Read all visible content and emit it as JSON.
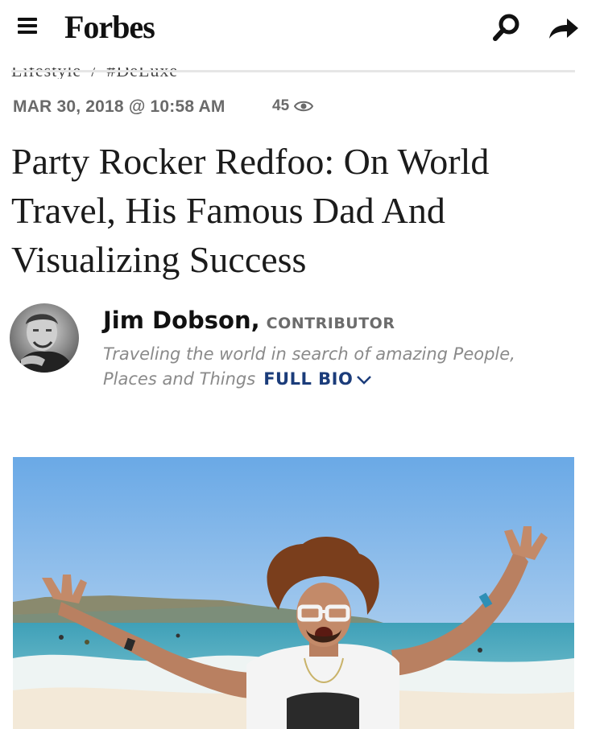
{
  "header": {
    "logo": "Forbes",
    "menu_icon": "hamburger-menu-icon",
    "search_icon": "search-icon",
    "share_icon": "share-arrow-icon"
  },
  "breadcrumb": {
    "section": "Lifestyle",
    "separator": "/",
    "channel": "#DeLuxe"
  },
  "article": {
    "date": "MAR 30, 2018 @ 10:58 AM",
    "views": "45",
    "headline": "Party Rocker Redfoo: On World Travel, His Famous Dad And Visualizing Success"
  },
  "author": {
    "name": "Jim Dobson,",
    "role": "CONTRIBUTOR",
    "bio_line1": "Traveling the world in search of amazing People,",
    "bio_line2": "Places and Things",
    "full_bio": "FULL BIO"
  },
  "colors": {
    "text": "#1b1b1b",
    "meta": "#6a6a6a",
    "bio": "#8a8a8a",
    "link": "#1b3c7a"
  }
}
